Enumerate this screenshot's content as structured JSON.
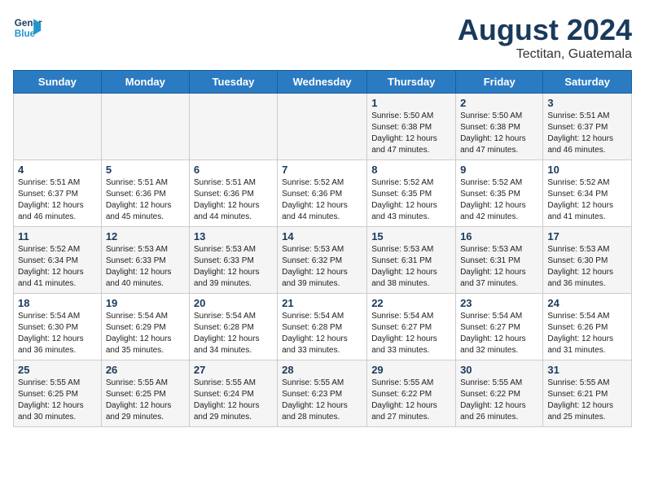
{
  "logo": {
    "line1": "General",
    "line2": "Blue"
  },
  "title": "August 2024",
  "subtitle": "Tectitan, Guatemala",
  "headers": [
    "Sunday",
    "Monday",
    "Tuesday",
    "Wednesday",
    "Thursday",
    "Friday",
    "Saturday"
  ],
  "weeks": [
    [
      {
        "day": "",
        "info": ""
      },
      {
        "day": "",
        "info": ""
      },
      {
        "day": "",
        "info": ""
      },
      {
        "day": "",
        "info": ""
      },
      {
        "day": "1",
        "info": "Sunrise: 5:50 AM\nSunset: 6:38 PM\nDaylight: 12 hours\nand 47 minutes."
      },
      {
        "day": "2",
        "info": "Sunrise: 5:50 AM\nSunset: 6:38 PM\nDaylight: 12 hours\nand 47 minutes."
      },
      {
        "day": "3",
        "info": "Sunrise: 5:51 AM\nSunset: 6:37 PM\nDaylight: 12 hours\nand 46 minutes."
      }
    ],
    [
      {
        "day": "4",
        "info": "Sunrise: 5:51 AM\nSunset: 6:37 PM\nDaylight: 12 hours\nand 46 minutes."
      },
      {
        "day": "5",
        "info": "Sunrise: 5:51 AM\nSunset: 6:36 PM\nDaylight: 12 hours\nand 45 minutes."
      },
      {
        "day": "6",
        "info": "Sunrise: 5:51 AM\nSunset: 6:36 PM\nDaylight: 12 hours\nand 44 minutes."
      },
      {
        "day": "7",
        "info": "Sunrise: 5:52 AM\nSunset: 6:36 PM\nDaylight: 12 hours\nand 44 minutes."
      },
      {
        "day": "8",
        "info": "Sunrise: 5:52 AM\nSunset: 6:35 PM\nDaylight: 12 hours\nand 43 minutes."
      },
      {
        "day": "9",
        "info": "Sunrise: 5:52 AM\nSunset: 6:35 PM\nDaylight: 12 hours\nand 42 minutes."
      },
      {
        "day": "10",
        "info": "Sunrise: 5:52 AM\nSunset: 6:34 PM\nDaylight: 12 hours\nand 41 minutes."
      }
    ],
    [
      {
        "day": "11",
        "info": "Sunrise: 5:52 AM\nSunset: 6:34 PM\nDaylight: 12 hours\nand 41 minutes."
      },
      {
        "day": "12",
        "info": "Sunrise: 5:53 AM\nSunset: 6:33 PM\nDaylight: 12 hours\nand 40 minutes."
      },
      {
        "day": "13",
        "info": "Sunrise: 5:53 AM\nSunset: 6:33 PM\nDaylight: 12 hours\nand 39 minutes."
      },
      {
        "day": "14",
        "info": "Sunrise: 5:53 AM\nSunset: 6:32 PM\nDaylight: 12 hours\nand 39 minutes."
      },
      {
        "day": "15",
        "info": "Sunrise: 5:53 AM\nSunset: 6:31 PM\nDaylight: 12 hours\nand 38 minutes."
      },
      {
        "day": "16",
        "info": "Sunrise: 5:53 AM\nSunset: 6:31 PM\nDaylight: 12 hours\nand 37 minutes."
      },
      {
        "day": "17",
        "info": "Sunrise: 5:53 AM\nSunset: 6:30 PM\nDaylight: 12 hours\nand 36 minutes."
      }
    ],
    [
      {
        "day": "18",
        "info": "Sunrise: 5:54 AM\nSunset: 6:30 PM\nDaylight: 12 hours\nand 36 minutes."
      },
      {
        "day": "19",
        "info": "Sunrise: 5:54 AM\nSunset: 6:29 PM\nDaylight: 12 hours\nand 35 minutes."
      },
      {
        "day": "20",
        "info": "Sunrise: 5:54 AM\nSunset: 6:28 PM\nDaylight: 12 hours\nand 34 minutes."
      },
      {
        "day": "21",
        "info": "Sunrise: 5:54 AM\nSunset: 6:28 PM\nDaylight: 12 hours\nand 33 minutes."
      },
      {
        "day": "22",
        "info": "Sunrise: 5:54 AM\nSunset: 6:27 PM\nDaylight: 12 hours\nand 33 minutes."
      },
      {
        "day": "23",
        "info": "Sunrise: 5:54 AM\nSunset: 6:27 PM\nDaylight: 12 hours\nand 32 minutes."
      },
      {
        "day": "24",
        "info": "Sunrise: 5:54 AM\nSunset: 6:26 PM\nDaylight: 12 hours\nand 31 minutes."
      }
    ],
    [
      {
        "day": "25",
        "info": "Sunrise: 5:55 AM\nSunset: 6:25 PM\nDaylight: 12 hours\nand 30 minutes."
      },
      {
        "day": "26",
        "info": "Sunrise: 5:55 AM\nSunset: 6:25 PM\nDaylight: 12 hours\nand 29 minutes."
      },
      {
        "day": "27",
        "info": "Sunrise: 5:55 AM\nSunset: 6:24 PM\nDaylight: 12 hours\nand 29 minutes."
      },
      {
        "day": "28",
        "info": "Sunrise: 5:55 AM\nSunset: 6:23 PM\nDaylight: 12 hours\nand 28 minutes."
      },
      {
        "day": "29",
        "info": "Sunrise: 5:55 AM\nSunset: 6:22 PM\nDaylight: 12 hours\nand 27 minutes."
      },
      {
        "day": "30",
        "info": "Sunrise: 5:55 AM\nSunset: 6:22 PM\nDaylight: 12 hours\nand 26 minutes."
      },
      {
        "day": "31",
        "info": "Sunrise: 5:55 AM\nSunset: 6:21 PM\nDaylight: 12 hours\nand 25 minutes."
      }
    ]
  ]
}
